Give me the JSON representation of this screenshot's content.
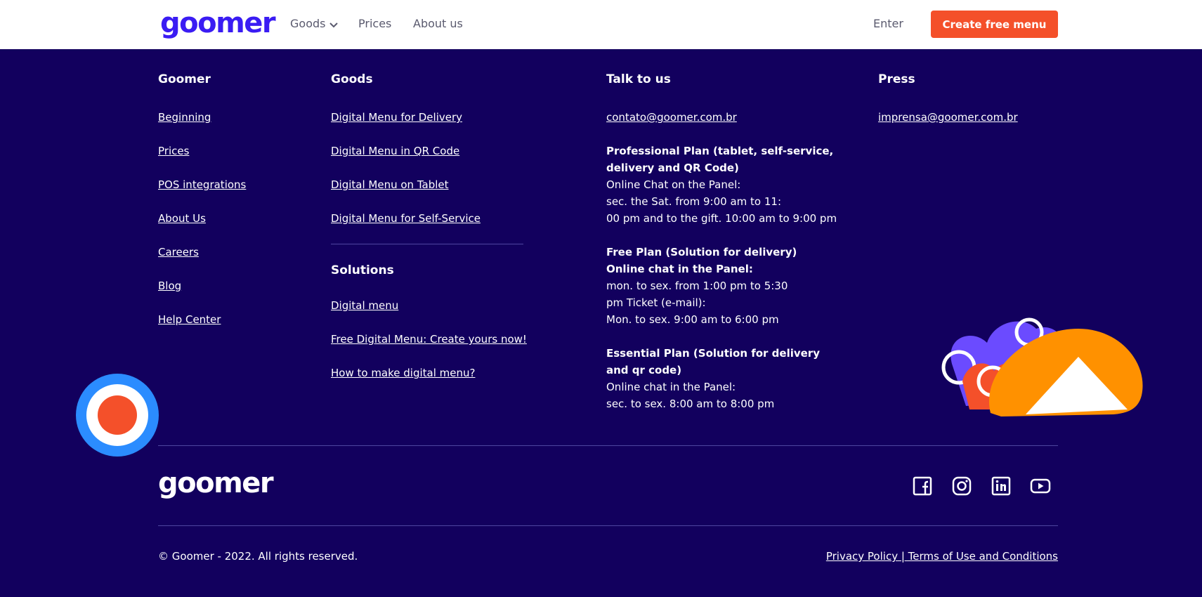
{
  "header": {
    "brand": "goomer",
    "nav": [
      {
        "label": "Goods"
      },
      {
        "label": "Prices"
      },
      {
        "label": "About us"
      }
    ],
    "enter_label": "Enter",
    "cta_label": "Create free menu"
  },
  "footer": {
    "goomer": {
      "title": "Goomer",
      "links": [
        "Beginning",
        "Prices",
        "POS integrations",
        "About Us",
        "Careers",
        "Blog",
        "Help Center"
      ]
    },
    "goods": {
      "title": "Goods",
      "links": [
        "Digital Menu for Delivery",
        "Digital Menu in QR Code",
        "Digital Menu on Tablet",
        "Digital Menu for Self-Service"
      ]
    },
    "solutions": {
      "title": "Solutions",
      "links": [
        "Digital menu",
        "Free Digital Menu: Create yours now!",
        "How to make digital menu?"
      ]
    },
    "talk": {
      "title": "Talk to us",
      "email": "contato@goomer.com.br",
      "professional": {
        "title": "Professional Plan (tablet, self-service, delivery and QR Code)",
        "line1": "Online Chat on the Panel:",
        "line2": "sec. the Sat. from 9:00 am to 11:",
        "line3": "00 pm and to the gift. 10:00 am to 9:00 pm"
      },
      "free": {
        "title": "Free Plan (Solution for delivery)",
        "line1": "Online chat in the Panel:",
        "line2": "mon. to sex. from 1:00 pm to 5:30",
        "line3": "pm Ticket (e-mail):",
        "line4": "Mon. to sex. 9:00 am to 6:00 pm"
      },
      "essential": {
        "title": "Essential Plan (Solution for delivery and qr code)",
        "line1": "Online chat in the Panel:",
        "line2": "sec. to sex. 8:00 am to 8:00 pm"
      }
    },
    "press": {
      "title": "Press",
      "email": "imprensa@goomer.com.br"
    },
    "brand": "goomer",
    "social": [
      "facebook-icon",
      "instagram-icon",
      "linkedin-icon",
      "youtube-icon"
    ],
    "copyright": "© Goomer - 2022. All rights reserved.",
    "legal": "Privacy Policy | Terms of Use and Conditions"
  },
  "colors": {
    "brand_blue": "#3a1cf3",
    "footer_bg": "#12005e",
    "cta": "#f4502a",
    "deco_orange": "#ff9100",
    "deco_purple": "#6b4bff",
    "deco_blue": "#2b8cff"
  }
}
